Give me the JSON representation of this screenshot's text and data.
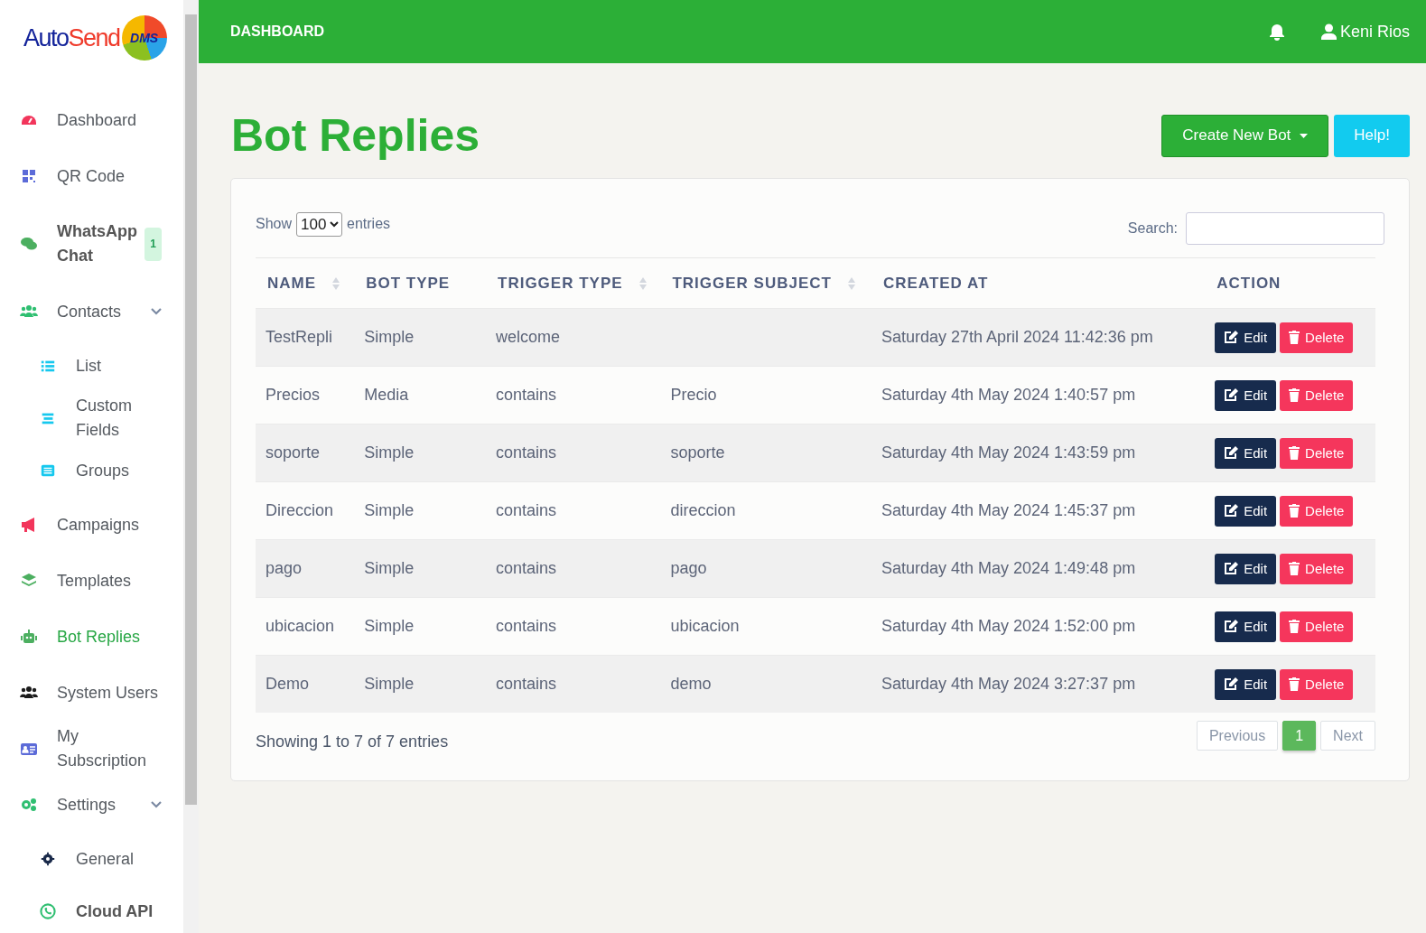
{
  "sidebar": {
    "logo": {
      "word_1": "Auto",
      "word_2": "Send",
      "badge": "DMS"
    },
    "items": [
      {
        "label": "Dashboard",
        "selected": false
      },
      {
        "label": "QR Code",
        "selected": false
      },
      {
        "label": "WhatsApp Chat",
        "selected": false,
        "bold": true,
        "badge": "1"
      },
      {
        "label": "Contacts",
        "selected": false,
        "expanded": true,
        "children": [
          {
            "label": "List",
            "selected": false
          },
          {
            "label": "Custom Fields",
            "selected": false
          },
          {
            "label": "Groups",
            "selected": false
          }
        ]
      },
      {
        "label": "Campaigns",
        "selected": false
      },
      {
        "label": "Templates",
        "selected": false
      },
      {
        "label": "Bot Replies",
        "selected": true
      },
      {
        "label": "System Users",
        "selected": false
      },
      {
        "label": "My Subscription",
        "selected": false
      },
      {
        "label": "Settings",
        "selected": false,
        "expanded": true,
        "children": [
          {
            "label": "General",
            "selected": false
          },
          {
            "label": "Cloud API",
            "selected": false,
            "bold": true
          }
        ]
      }
    ]
  },
  "topbar": {
    "title": "DASHBOARD",
    "user": "Keni Rios"
  },
  "page": {
    "title": "Bot Replies",
    "buttons": [
      {
        "label": "Create New Bot",
        "kind": "dropdown"
      },
      {
        "label": "Help!",
        "kind": "info"
      }
    ]
  },
  "table_controls": {
    "show_label": "Show",
    "page_size": "100",
    "entries_label": "entries",
    "search_label": "Search:"
  },
  "table": {
    "columns": [
      {
        "label": "NAME",
        "sortable": true
      },
      {
        "label": "BOT TYPE",
        "sortable": false
      },
      {
        "label": "TRIGGER TYPE",
        "sortable": true
      },
      {
        "label": "TRIGGER SUBJECT",
        "sortable": true
      },
      {
        "label": "CREATED AT",
        "sortable": false
      },
      {
        "label": "ACTION",
        "sortable": false
      }
    ],
    "rows": [
      {
        "cells": [
          "TestRepli",
          "Simple",
          "welcome",
          "",
          "Saturday 27th April 2024 11:42:36 pm"
        ],
        "actions": [
          "Edit",
          "Delete"
        ]
      },
      {
        "cells": [
          "Precios",
          "Media",
          "contains",
          "Precio",
          "Saturday 4th May 2024 1:40:57 pm"
        ],
        "actions": [
          "Edit",
          "Delete"
        ]
      },
      {
        "cells": [
          "soporte",
          "Simple",
          "contains",
          "soporte",
          "Saturday 4th May 2024 1:43:59 pm"
        ],
        "actions": [
          "Edit",
          "Delete"
        ]
      },
      {
        "cells": [
          "Direccion",
          "Simple",
          "contains",
          "direccion",
          "Saturday 4th May 2024 1:45:37 pm"
        ],
        "actions": [
          "Edit",
          "Delete"
        ]
      },
      {
        "cells": [
          "pago",
          "Simple",
          "contains",
          "pago",
          "Saturday 4th May 2024 1:49:48 pm"
        ],
        "actions": [
          "Edit",
          "Delete"
        ]
      },
      {
        "cells": [
          "ubicacion",
          "Simple",
          "contains",
          "ubicacion",
          "Saturday 4th May 2024 1:52:00 pm"
        ],
        "actions": [
          "Edit",
          "Delete"
        ]
      },
      {
        "cells": [
          "Demo",
          "Simple",
          "contains",
          "demo",
          "Saturday 4th May 2024 3:27:37 pm"
        ],
        "actions": [
          "Edit",
          "Delete"
        ]
      }
    ]
  },
  "footer": {
    "info": "Showing 1 to 7 of 7 entries",
    "pagination": [
      {
        "label": "Previous",
        "disabled": true,
        "selected": false
      },
      {
        "label": "1",
        "disabled": false,
        "selected": true
      },
      {
        "label": "Next",
        "disabled": true,
        "selected": false
      }
    ]
  }
}
